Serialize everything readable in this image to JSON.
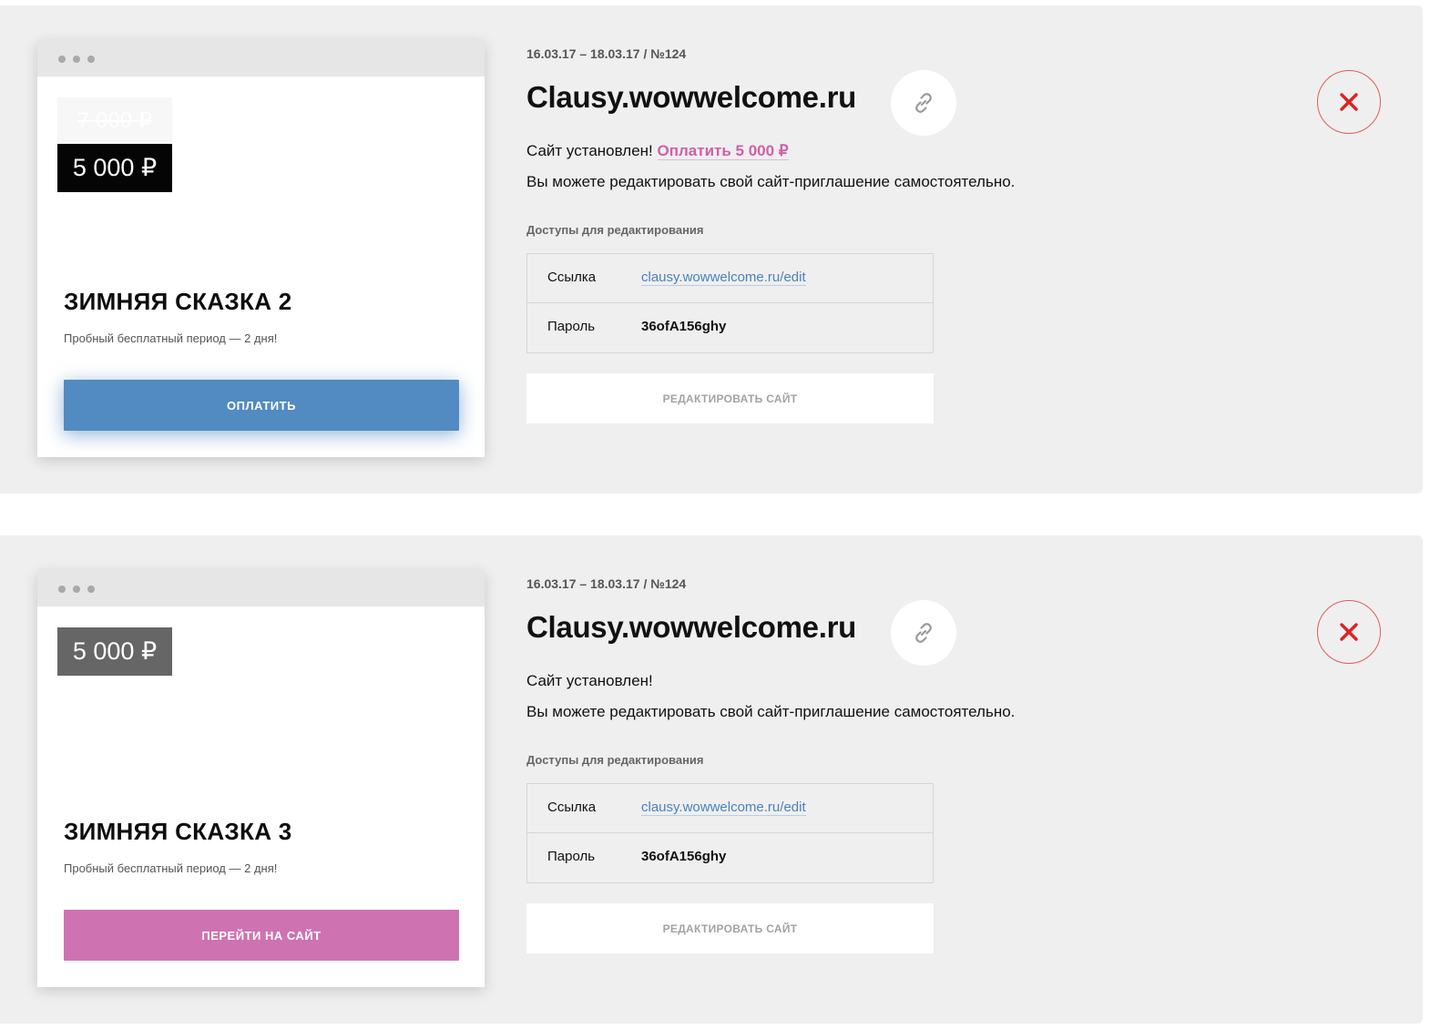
{
  "orders": [
    {
      "old_price": "7 000 ₽",
      "price": "5 000 ₽",
      "theme_name": "ЗИМНЯЯ СКАЗКА 2",
      "trial_note": "Пробный бесплатный период — 2 дня!",
      "primary_button": "ОПЛАТИТЬ",
      "meta": "16.03.17 – 18.03.17 / №124",
      "domain": "Clausy.wowwelcome.ru",
      "status": "Сайт установлен!",
      "pay_link": "Оплатить 5 000 ₽",
      "description": "Вы можете редактировать свой сайт-приглашение самостоятельно.",
      "access_title": "Доступы для редактирования",
      "link_label": "Ссылка",
      "link_value": "clausy.wowwelcome.ru/edit",
      "password_label": "Пароль",
      "password_value": "36ofA156ghy",
      "edit_button": "РЕДАКТИРОВАТЬ САЙТ"
    },
    {
      "price": "5 000 ₽",
      "theme_name": "ЗИМНЯЯ СКАЗКА 3",
      "trial_note": "Пробный бесплатный период — 2 дня!",
      "primary_button": "ПЕРЕЙТИ НА САЙТ",
      "meta": "16.03.17 – 18.03.17 / №124",
      "domain": "Clausy.wowwelcome.ru",
      "status": "Сайт установлен!",
      "description": "Вы можете редактировать свой сайт-приглашение самостоятельно.",
      "access_title": "Доступы для редактирования",
      "link_label": "Ссылка",
      "link_value": "clausy.wowwelcome.ru/edit",
      "password_label": "Пароль",
      "password_value": "36ofA156ghy",
      "edit_button": "РЕДАКТИРОВАТЬ САЙТ"
    }
  ],
  "icons": {
    "link": "link-icon",
    "close": "close-icon"
  },
  "colors": {
    "pay_button": "#518bc1",
    "go_to_site_button": "#cf72b1",
    "pay_link": "#d05fa8",
    "close": "#e02020",
    "url_link": "#4a82bd"
  }
}
